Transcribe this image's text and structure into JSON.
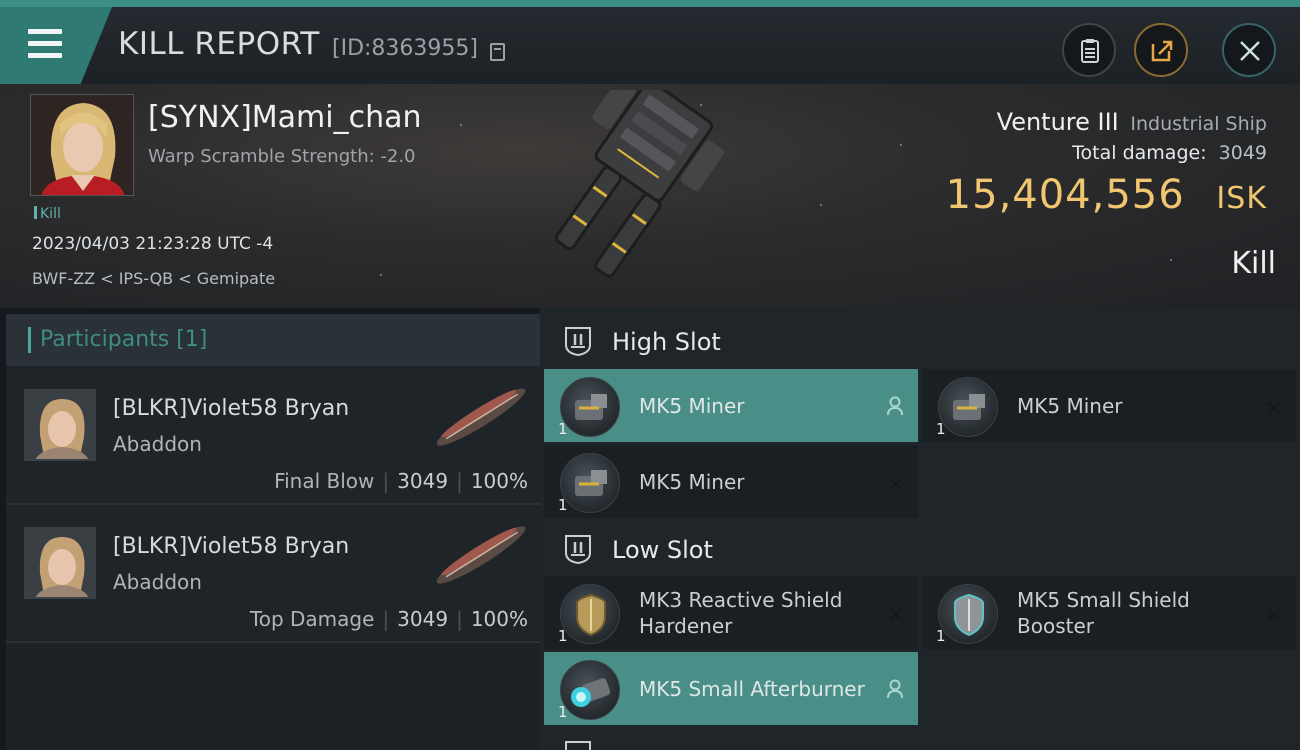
{
  "header": {
    "title": "KILL REPORT",
    "report_id": "[ID:8363955]"
  },
  "victim": {
    "name": "[SYNX]Mami_chan",
    "warp_scramble": "Warp Scramble Strength: -2.0",
    "tag": "Kill",
    "timestamp": "2023/04/03 21:23:28 UTC -4",
    "location": "BWF-ZZ < IPS-QB < Gemipate",
    "ship_name": "Venture III",
    "ship_class": "Industrial Ship",
    "total_damage_label": "Total damage:",
    "total_damage": "3049",
    "isk_value": "15,404,556",
    "isk_unit": "ISK",
    "result": "Kill"
  },
  "participants": {
    "title": "Participants [1]",
    "rows": [
      {
        "name": "[BLKR]Violet58 Bryan",
        "ship": "Abaddon",
        "role": "Final Blow",
        "damage": "3049",
        "percent": "100%"
      },
      {
        "name": "[BLKR]Violet58 Bryan",
        "ship": "Abaddon",
        "role": "Top Damage",
        "damage": "3049",
        "percent": "100%"
      }
    ]
  },
  "fitting": {
    "high_slot": {
      "title": "High Slot",
      "modules": [
        {
          "name": "MK5 Miner",
          "qty": "1",
          "icon": "miner-icon",
          "state": "active"
        },
        {
          "name": "MK5 Miner",
          "qty": "1",
          "icon": "miner-icon",
          "state": "destroyed"
        },
        {
          "name": "MK5 Miner",
          "qty": "1",
          "icon": "miner-icon",
          "state": "destroyed"
        }
      ]
    },
    "low_slot": {
      "title": "Low Slot",
      "modules": [
        {
          "name": "MK3 Reactive Shield Hardener",
          "qty": "1",
          "icon": "shield-hardener-icon",
          "state": "destroyed"
        },
        {
          "name": "MK5 Small Shield Booster",
          "qty": "1",
          "icon": "shield-booster-icon",
          "state": "destroyed"
        },
        {
          "name": "MK5 Small Afterburner",
          "qty": "1",
          "icon": "afterburner-icon",
          "state": "active"
        }
      ]
    }
  },
  "colors": {
    "accent": "#3b8f86",
    "active_module": "#4a8f87",
    "isk": "#f0c670"
  }
}
